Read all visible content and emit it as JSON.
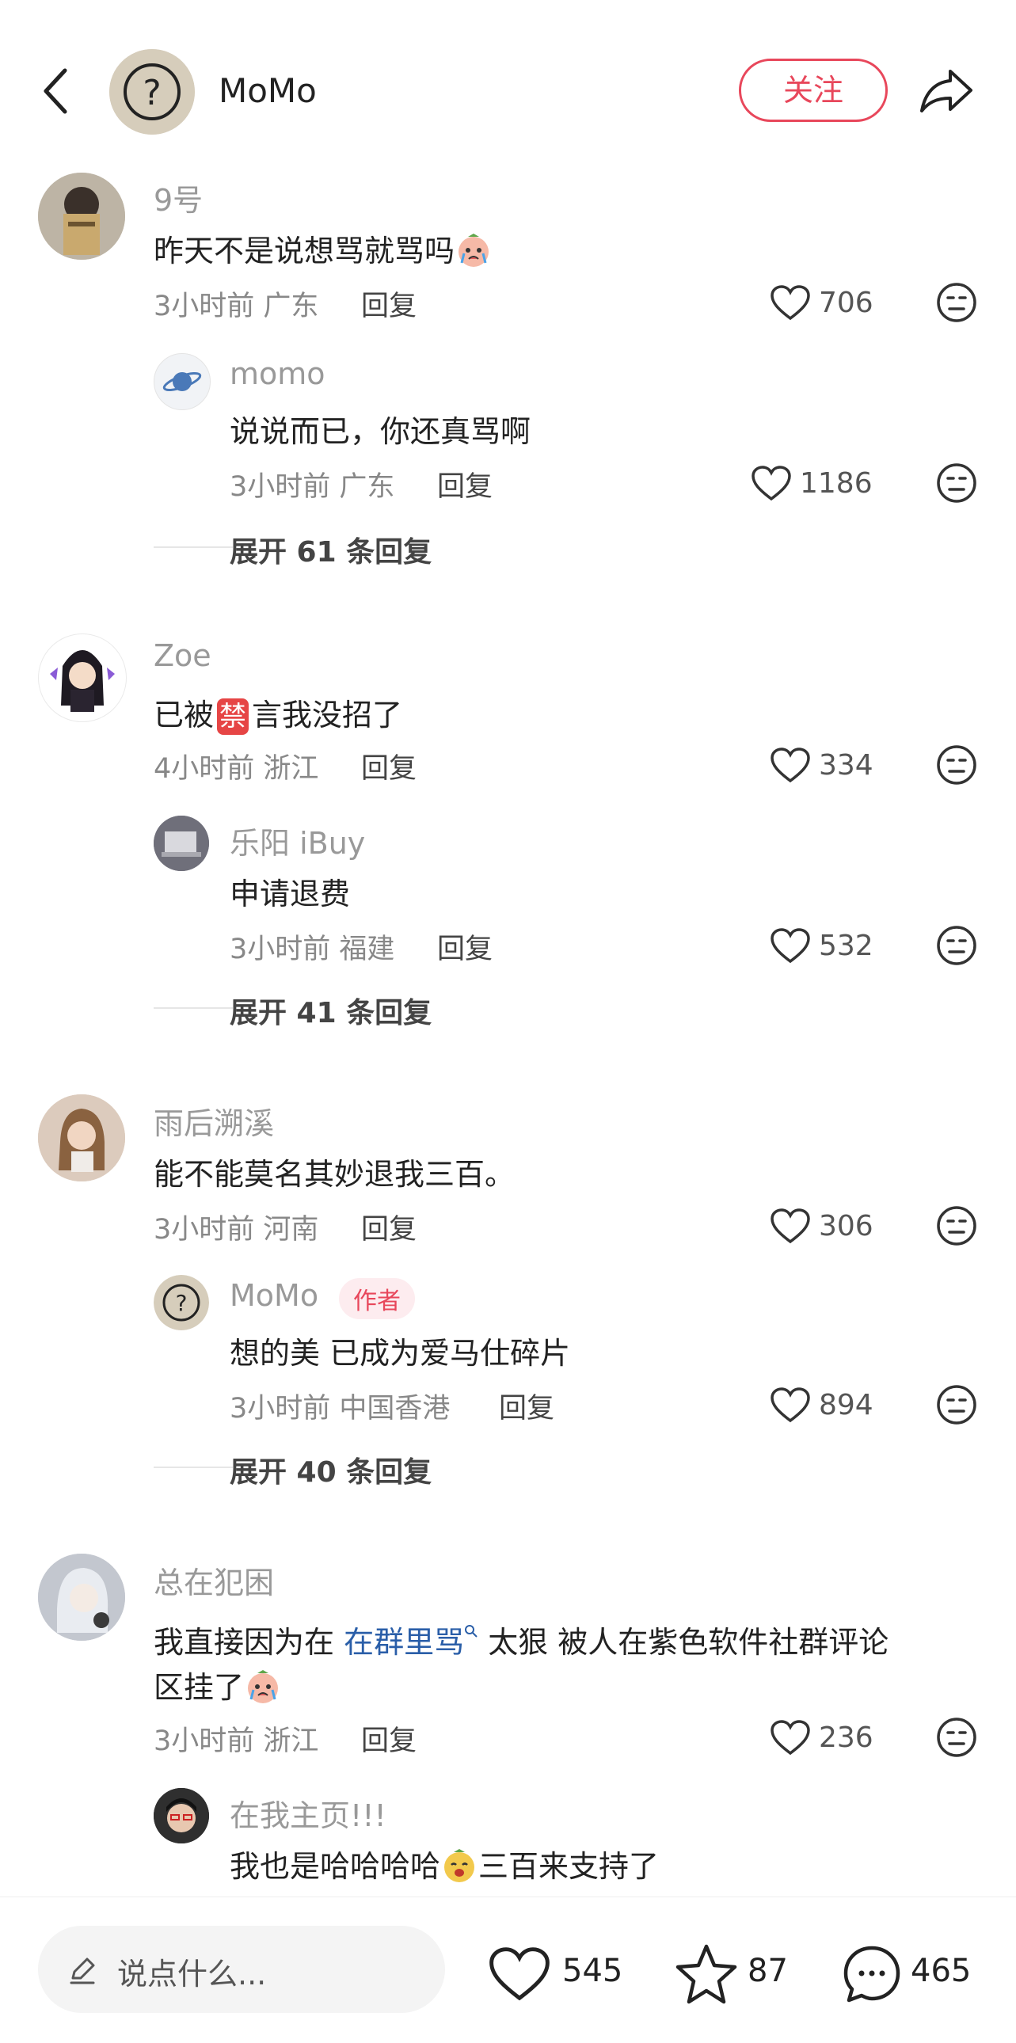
{
  "header": {
    "user_name": "MoMo",
    "follow_label": "关注"
  },
  "comments": [
    {
      "name": "9号",
      "text": "昨天不是说想骂就骂吗",
      "meta": "3小时前 广东",
      "reply": "回复",
      "likes": "706",
      "sub": {
        "name": "momo",
        "text": "说说而已，你还真骂啊",
        "meta": "3小时前 广东",
        "reply": "回复",
        "likes": "1186"
      },
      "expand": "展开 61 条回复"
    },
    {
      "name": "Zoe",
      "text_pre": "已被",
      "text_ban": "禁",
      "text_post": "言我没招了",
      "meta": "4小时前 浙江",
      "reply": "回复",
      "likes": "334",
      "sub": {
        "name": "乐阳 iBuy",
        "text": "申请退费",
        "meta": "3小时前 福建",
        "reply": "回复",
        "likes": "532"
      },
      "expand": "展开 41 条回复"
    },
    {
      "name": "雨后溯溪",
      "text": "能不能莫名其妙退我三百。",
      "meta": "3小时前 河南",
      "reply": "回复",
      "likes": "306",
      "sub": {
        "name": "MoMo",
        "badge": "作者",
        "text": "想的美 已成为爱马仕碎片",
        "meta": "3小时前 中国香港",
        "reply": "回复",
        "likes": "894"
      },
      "expand": "展开 40 条回复"
    },
    {
      "name": "总在犯困",
      "text_pre": "我直接因为在 ",
      "text_topic": "在群里骂",
      "text_post": " 太狠 被人在紫色软件社群评论",
      "text_line2": "区挂了",
      "meta": "3小时前 浙江",
      "reply": "回复",
      "likes": "236",
      "sub": {
        "name": "在我主页!!!",
        "text_pre": "我也是哈哈哈哈",
        "text_post": "三百来支持了"
      }
    }
  ],
  "bottom": {
    "placeholder": "说点什么...",
    "likes": "545",
    "stars": "87",
    "comments": "465"
  },
  "icons": {
    "back": "chevron-left-icon",
    "share": "share-arrow-icon",
    "like": "heart-outline-icon",
    "dislike": "meh-face-icon",
    "star": "star-outline-icon",
    "comment": "chat-bubble-icon",
    "pen": "pen-icon"
  }
}
